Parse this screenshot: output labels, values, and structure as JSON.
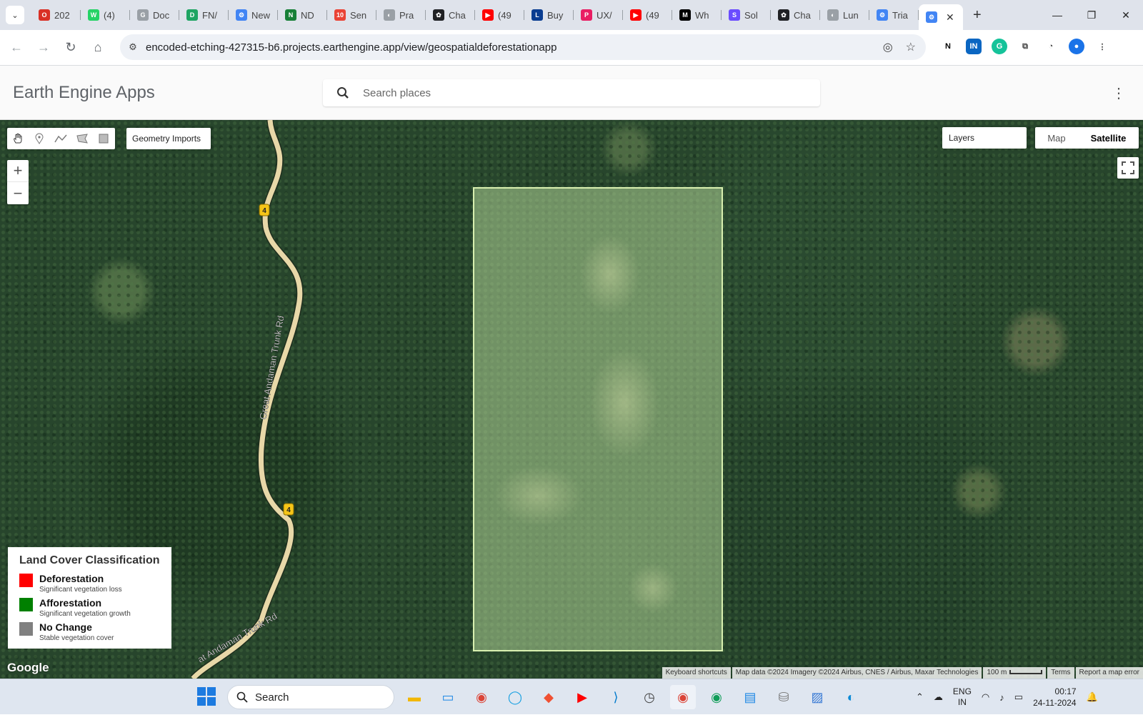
{
  "browser": {
    "tabs": [
      {
        "label": "202",
        "color": "#d93025",
        "glyph": "O"
      },
      {
        "label": "(4)",
        "color": "#25d366",
        "glyph": "W"
      },
      {
        "label": "Doc",
        "color": "#9aa0a6",
        "glyph": "G"
      },
      {
        "label": "FN/",
        "color": "#1fa463",
        "glyph": "D"
      },
      {
        "label": "New",
        "color": "#4285f4",
        "glyph": "⚙"
      },
      {
        "label": "ND",
        "color": "#188038",
        "glyph": "N"
      },
      {
        "label": "Sen",
        "color": "#ea4335",
        "glyph": "10"
      },
      {
        "label": "Pra",
        "color": "#9aa0a6",
        "glyph": "◐"
      },
      {
        "label": "Cha",
        "color": "#202124",
        "glyph": "✿"
      },
      {
        "label": "(49",
        "color": "#ff0000",
        "glyph": "▶"
      },
      {
        "label": "Buy",
        "color": "#0a3d91",
        "glyph": "L"
      },
      {
        "label": "UX/",
        "color": "#e91e63",
        "glyph": "P"
      },
      {
        "label": "(49",
        "color": "#ff0000",
        "glyph": "▶"
      },
      {
        "label": "Wh",
        "color": "#000000",
        "glyph": "M"
      },
      {
        "label": "Sol",
        "color": "#6a4cff",
        "glyph": "S"
      },
      {
        "label": "Cha",
        "color": "#202124",
        "glyph": "✿"
      },
      {
        "label": "Lun",
        "color": "#9aa0a6",
        "glyph": "◐"
      },
      {
        "label": "Tria",
        "color": "#4285f4",
        "glyph": "⚙"
      }
    ],
    "active_tab": {
      "color": "#4285f4",
      "glyph": "⚙"
    },
    "url": "encoded-etching-427315-b6.projects.earthengine.app/view/geospatialdeforestationapp"
  },
  "app": {
    "title": "Earth Engine Apps",
    "search_placeholder": "Search places"
  },
  "map": {
    "geometry_imports": "Geometry Imports",
    "layers": "Layers",
    "map_type_map": "Map",
    "map_type_satellite": "Satellite",
    "zoom_in": "+",
    "zoom_out": "−",
    "road_name": "Great Andaman Trunk Rd",
    "road_name_bottom": "at Andaman Trunk Rd",
    "road_shield": "4",
    "google_logo": "Google",
    "attribution": {
      "keyboard": "Keyboard shortcuts",
      "data": "Map data ©2024 Imagery ©2024 Airbus, CNES / Airbus, Maxar Technologies",
      "scale": "100 m",
      "terms": "Terms",
      "report": "Report a map error"
    }
  },
  "legend": {
    "title": "Land Cover Classification",
    "items": [
      {
        "label": "Deforestation",
        "sub": "Significant vegetation loss",
        "color": "#ff0000"
      },
      {
        "label": "Afforestation",
        "sub": "Significant vegetation growth",
        "color": "#008000"
      },
      {
        "label": "No Change",
        "sub": "Stable vegetation cover",
        "color": "#808080"
      }
    ]
  },
  "taskbar": {
    "search": "Search",
    "lang_1": "ENG",
    "lang_2": "IN",
    "time": "00:17",
    "date": "24-11-2024"
  }
}
